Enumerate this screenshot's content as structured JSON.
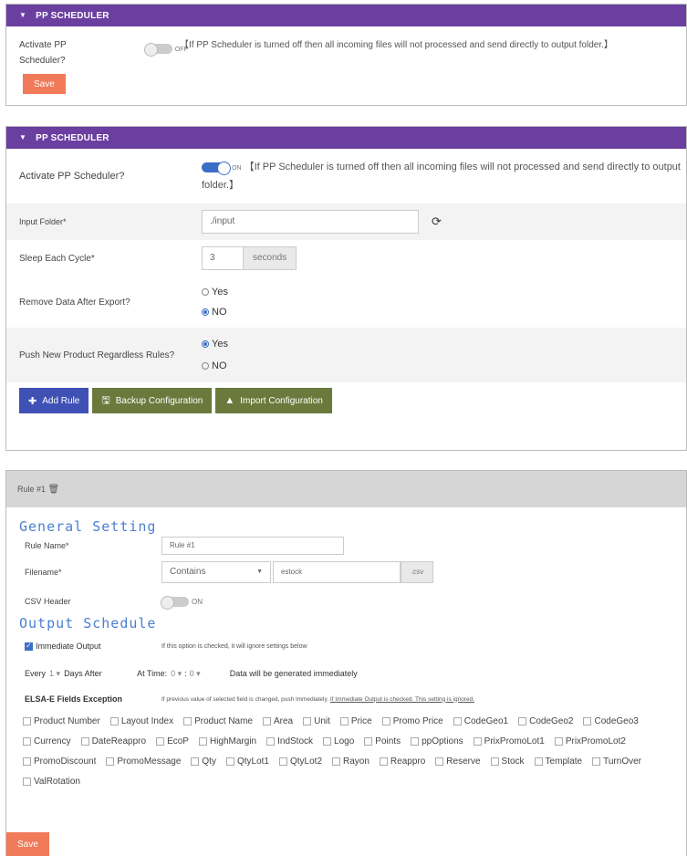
{
  "panel1": {
    "header": "PP SCHEDULER",
    "activate_label": "Activate PP Scheduler?",
    "toggle_state": "OFF",
    "note": "【If PP Scheduler is turned off then all incoming files will not processed and send directly to output folder.】",
    "save_label": "Save"
  },
  "panel2": {
    "header": "PP SCHEDULER",
    "activate_label": "Activate PP Scheduler?",
    "toggle_state": "ON",
    "note": "【If PP Scheduler is turned off then all incoming files will not processed and send directly to output folder.】",
    "input_folder_label": "Input Folder*",
    "input_folder_value": "./input",
    "sleep_label": "Sleep Each Cycle*",
    "sleep_value": "3",
    "sleep_unit": "seconds",
    "remove_label": "Remove Data After Export?",
    "remove_options": [
      "Yes",
      "NO"
    ],
    "push_label": "Push New Product Regardless Rules?",
    "push_options": [
      "Yes",
      "NO"
    ],
    "btn_add_rule": "Add Rule",
    "btn_backup": "Backup Configuration",
    "btn_import": "Import Configuration"
  },
  "panel3": {
    "header": "Rule #1",
    "general_title": "General Setting",
    "rule_name_label": "Rule Name*",
    "rule_name_value": "Rule #1",
    "filename_label": "Filename*",
    "filename_mode": "Contains",
    "filename_value": "estock",
    "filename_ext": ".csv",
    "csv_header_label": "CSV Header",
    "csv_header_toggle": "ON",
    "output_title": "Output Schedule",
    "immediate_label": "Immediate Output",
    "immediate_note": "If this option is checked, it will ignore settings below",
    "every_label": "Every",
    "every_value": "1",
    "days_after_label": "Days After",
    "at_time_label": "At Time",
    "at_time_hour": "0",
    "at_time_min": "0",
    "generated_note": "Data will be generated immediately",
    "elsa_label": "ELSA-E Fields Exception",
    "elsa_note_a": "If previous value of selected field is changed, push immediately.",
    "elsa_note_b": "If Immediate Output is checked. This setting is ignored.",
    "fields": [
      "Product Number",
      "Layout Index",
      "Product Name",
      "Area",
      "Unit",
      "Price",
      "Promo Price",
      "CodeGeo1",
      "CodeGeo2",
      "CodeGeo3",
      "Currency",
      "DateReappro",
      "EcoP",
      "HighMargin",
      "IndStock",
      "Logo",
      "Points",
      "ppOptions",
      "PrixPromoLot1",
      "PrixPromoLot2",
      "PromoDiscount",
      "PromoMessage",
      "Qty",
      "QtyLot1",
      "QtyLot2",
      "Rayon",
      "Reappro",
      "Reserve",
      "Stock",
      "Template",
      "TurnOver",
      "ValRotation"
    ],
    "save_label": "Save"
  },
  "colors": {
    "header": "#6a3fa0",
    "save": "#f07a5a",
    "add_rule": "#3f51b5",
    "olive": "#6b7a3c",
    "accent": "#4a7fd0"
  }
}
